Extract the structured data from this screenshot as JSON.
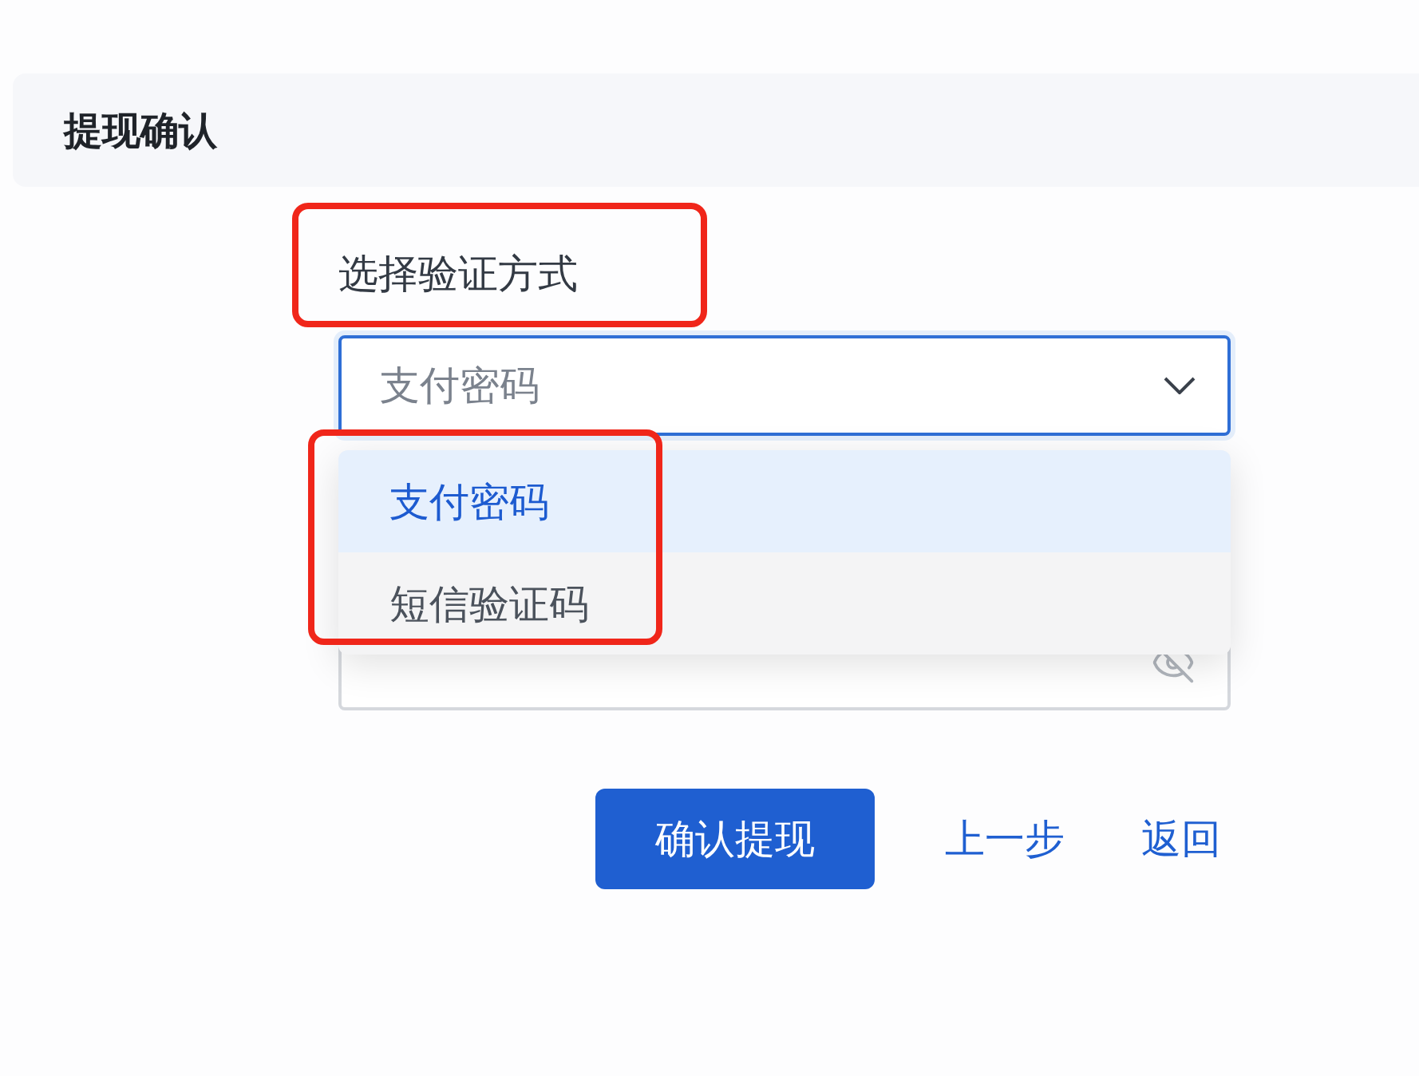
{
  "header": {
    "title": "提现确认"
  },
  "verify": {
    "label": "选择验证方式",
    "label_highlighted": true,
    "value": "支付密码",
    "expanded": true,
    "options_highlighted": true,
    "options": [
      {
        "label": "支付密码",
        "selected": true
      },
      {
        "label": "短信验证码",
        "selected": false
      }
    ]
  },
  "actions": [
    {
      "kind": "primary",
      "label": "确认提现"
    },
    {
      "kind": "link",
      "label": "上一步"
    },
    {
      "kind": "link",
      "label": "返回"
    }
  ]
}
